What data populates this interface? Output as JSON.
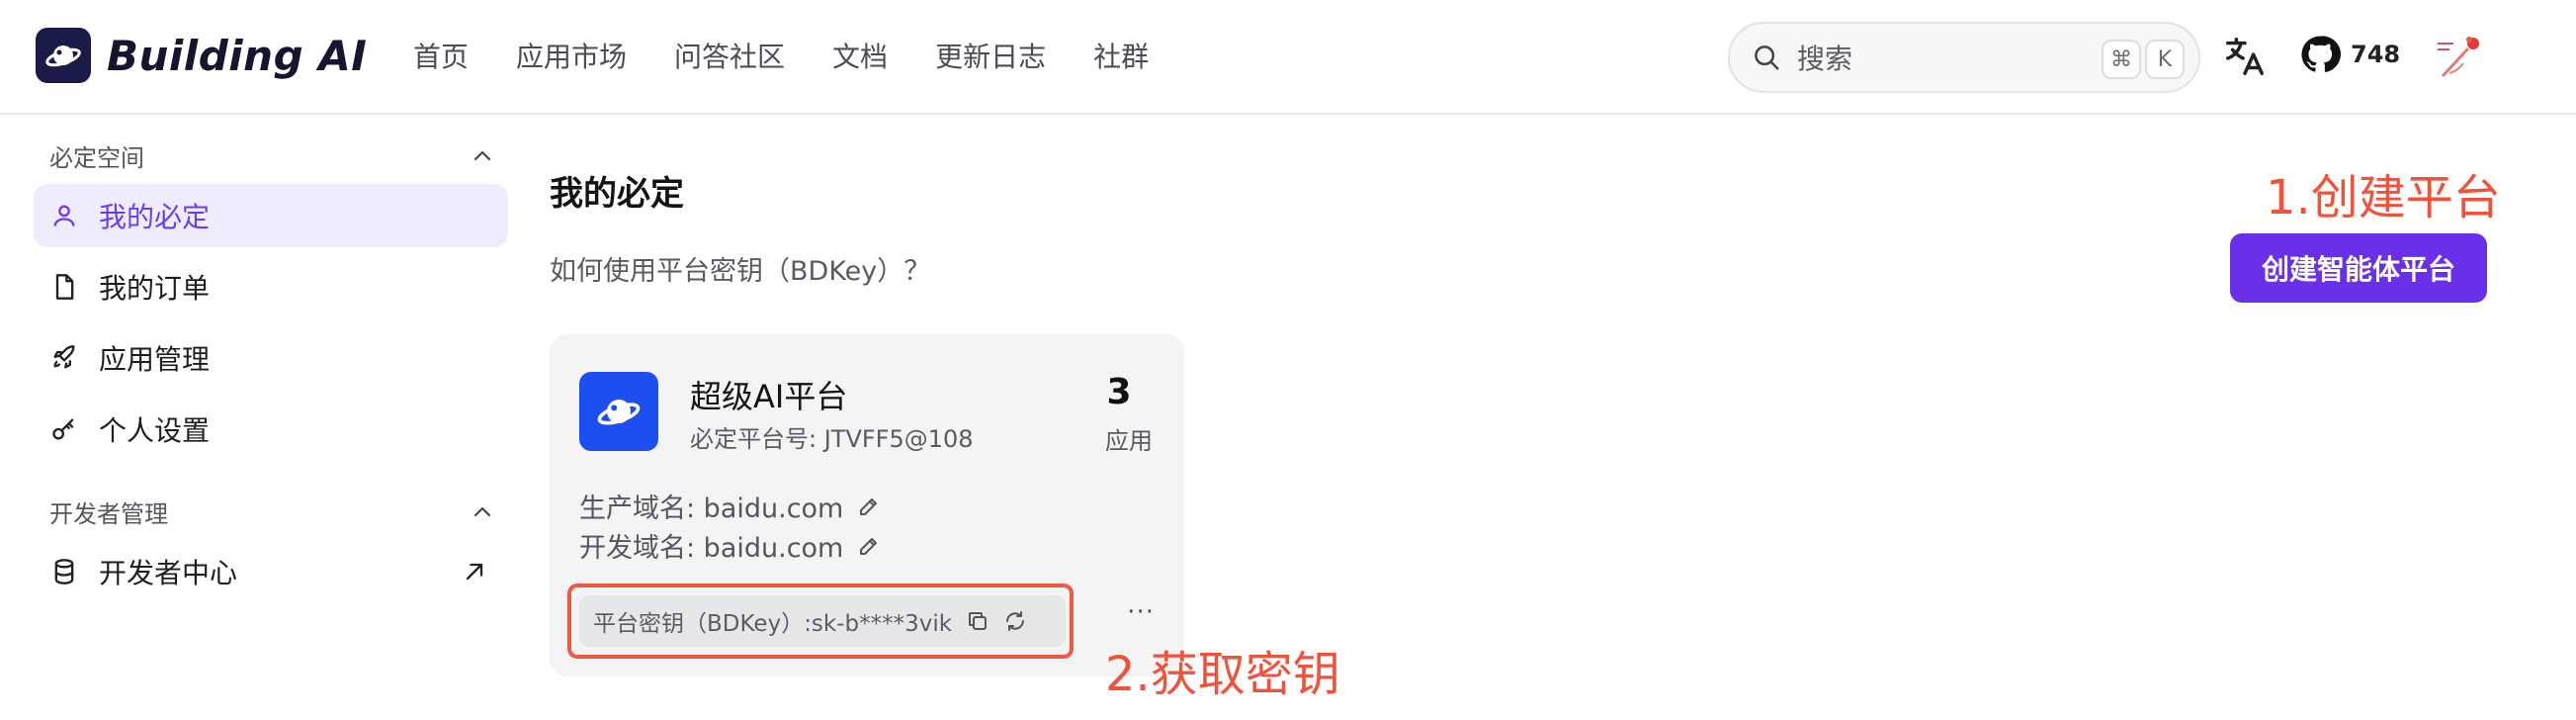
{
  "header": {
    "brand": "Building AI",
    "nav": [
      "首页",
      "应用市场",
      "问答社区",
      "文档",
      "更新日志",
      "社群"
    ],
    "search": {
      "placeholder": "搜索",
      "shortcut_key_1": "⌘",
      "shortcut_key_2": "K"
    },
    "github_stars": "748"
  },
  "sidebar": {
    "groups": [
      {
        "title": "必定空间",
        "items": [
          {
            "label": "我的必定",
            "icon": "user-icon",
            "active": true
          },
          {
            "label": "我的订单",
            "icon": "file-icon",
            "active": false
          },
          {
            "label": "应用管理",
            "icon": "rocket-icon",
            "active": false
          },
          {
            "label": "个人设置",
            "icon": "key-icon",
            "active": false
          }
        ]
      },
      {
        "title": "开发者管理",
        "items": [
          {
            "label": "开发者中心",
            "icon": "database-icon",
            "active": false
          }
        ]
      }
    ]
  },
  "main": {
    "title": "我的必定",
    "help_link": "如何使用平台密钥（BDKey）？",
    "create_button": "创建智能体平台",
    "card": {
      "name": "超级AI平台",
      "platform_id": "必定平台号: JTVFF5@108",
      "app_count": "3",
      "app_count_label": "应用",
      "prod_domain": "生产域名: baidu.com",
      "dev_domain": "开发域名: baidu.com",
      "key": "平台密钥（BDKey）:sk-b****3vik"
    }
  },
  "annotations": {
    "step1": "1.创建平台",
    "step2": "2.获取密钥"
  },
  "colors": {
    "accent": "#6a2fe8",
    "active_bg": "#efedfd",
    "annotation": "#f0533b",
    "card_logo": "#1d4ff0"
  }
}
